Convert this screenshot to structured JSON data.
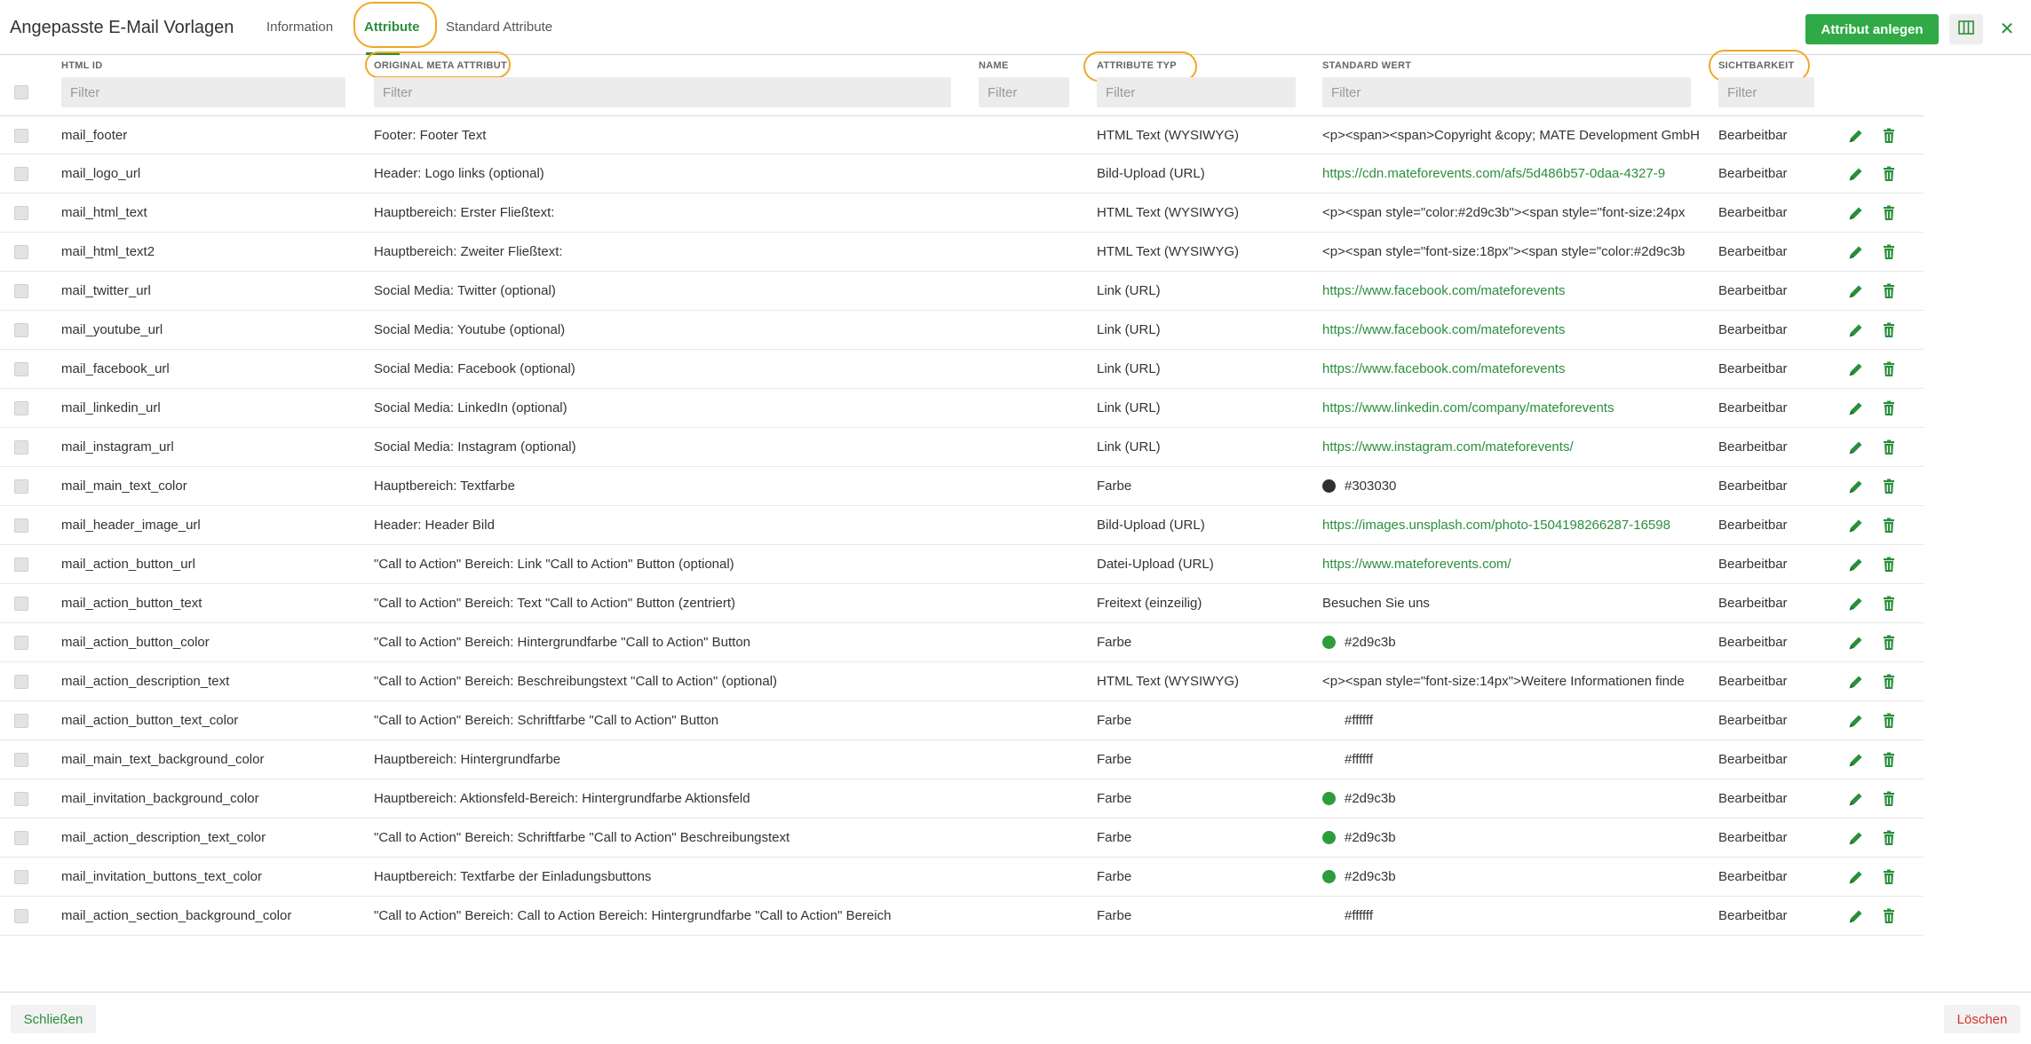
{
  "header": {
    "title": "Angepasste E-Mail Vorlagen",
    "tabs": [
      {
        "label": "Information",
        "active": false
      },
      {
        "label": "Attribute",
        "active": true
      },
      {
        "label": "Standard Attribute",
        "active": false
      }
    ],
    "add_button": "Attribut anlegen",
    "columns_icon": "columns-icon",
    "close_icon": "close-icon",
    "close_glyph": "✕"
  },
  "columns": {
    "html_id": "HTML ID",
    "meta": "ORIGINAL META ATTRIBUT",
    "name": "NAME",
    "type": "ATTRIBUTE TYP",
    "value": "STANDARD WERT",
    "visibility": "SICHTBARKEIT"
  },
  "filter_placeholder": "Filter",
  "colors": {
    "accent": "#2faa47",
    "link": "#2a8f3c",
    "danger": "#d9302a",
    "highlight": "#f0a825"
  },
  "rows": [
    {
      "html_id": "mail_footer",
      "meta": "Footer: Footer Text",
      "name": "",
      "type": "HTML Text (WYSIWYG)",
      "value": "<p><span><span>Copyright &copy; MATE Development GmbH",
      "kind": "text",
      "visibility": "Bearbeitbar"
    },
    {
      "html_id": "mail_logo_url",
      "meta": "Header: Logo links (optional)",
      "name": "",
      "type": "Bild-Upload (URL)",
      "value": "https://cdn.mateforevents.com/afs/5d486b57-0daa-4327-9",
      "kind": "link",
      "visibility": "Bearbeitbar"
    },
    {
      "html_id": "mail_html_text",
      "meta": "Hauptbereich: Erster Fließtext:",
      "name": "",
      "type": "HTML Text (WYSIWYG)",
      "value": "<p><span style=\"color:#2d9c3b\"><span style=\"font-size:24px",
      "kind": "text",
      "visibility": "Bearbeitbar"
    },
    {
      "html_id": "mail_html_text2",
      "meta": "Hauptbereich: Zweiter Fließtext:",
      "name": "",
      "type": "HTML Text (WYSIWYG)",
      "value": "<p><span style=\"font-size:18px\"><span style=\"color:#2d9c3b",
      "kind": "text",
      "visibility": "Bearbeitbar"
    },
    {
      "html_id": "mail_twitter_url",
      "meta": "Social Media: Twitter (optional)",
      "name": "",
      "type": "Link (URL)",
      "value": "https://www.facebook.com/mateforevents",
      "kind": "link",
      "visibility": "Bearbeitbar"
    },
    {
      "html_id": "mail_youtube_url",
      "meta": "Social Media: Youtube (optional)",
      "name": "",
      "type": "Link (URL)",
      "value": "https://www.facebook.com/mateforevents",
      "kind": "link",
      "visibility": "Bearbeitbar"
    },
    {
      "html_id": "mail_facebook_url",
      "meta": "Social Media: Facebook (optional)",
      "name": "",
      "type": "Link (URL)",
      "value": "https://www.facebook.com/mateforevents",
      "kind": "link",
      "visibility": "Bearbeitbar"
    },
    {
      "html_id": "mail_linkedin_url",
      "meta": "Social Media: LinkedIn (optional)",
      "name": "",
      "type": "Link (URL)",
      "value": "https://www.linkedin.com/company/mateforevents",
      "kind": "link",
      "visibility": "Bearbeitbar"
    },
    {
      "html_id": "mail_instagram_url",
      "meta": "Social Media: Instagram (optional)",
      "name": "",
      "type": "Link (URL)",
      "value": "https://www.instagram.com/mateforevents/",
      "kind": "link",
      "visibility": "Bearbeitbar"
    },
    {
      "html_id": "mail_main_text_color",
      "meta": "Hauptbereich: Textfarbe",
      "name": "",
      "type": "Farbe",
      "value": "#303030",
      "kind": "color",
      "swatch": "#303030",
      "visibility": "Bearbeitbar"
    },
    {
      "html_id": "mail_header_image_url",
      "meta": "Header: Header Bild",
      "name": "",
      "type": "Bild-Upload (URL)",
      "value": "https://images.unsplash.com/photo-1504198266287-16598",
      "kind": "link",
      "visibility": "Bearbeitbar"
    },
    {
      "html_id": "mail_action_button_url",
      "meta": "\"Call to Action\" Bereich: Link \"Call to Action\" Button (optional)",
      "name": "",
      "type": "Datei-Upload (URL)",
      "value": "https://www.mateforevents.com/",
      "kind": "link",
      "visibility": "Bearbeitbar"
    },
    {
      "html_id": "mail_action_button_text",
      "meta": "\"Call to Action\" Bereich: Text \"Call to Action\" Button (zentriert)",
      "name": "",
      "type": "Freitext (einzeilig)",
      "value": "Besuchen Sie uns",
      "kind": "text",
      "visibility": "Bearbeitbar"
    },
    {
      "html_id": "mail_action_button_color",
      "meta": "\"Call to Action\" Bereich: Hintergrundfarbe \"Call to Action\" Button",
      "name": "",
      "type": "Farbe",
      "value": "#2d9c3b",
      "kind": "color",
      "swatch": "#2d9c3b",
      "visibility": "Bearbeitbar"
    },
    {
      "html_id": "mail_action_description_text",
      "meta": "\"Call to Action\" Bereich: Beschreibungstext \"Call to Action\" (optional)",
      "name": "",
      "type": "HTML Text (WYSIWYG)",
      "value": "<p><span style=\"font-size:14px\">Weitere Informationen finde",
      "kind": "text",
      "visibility": "Bearbeitbar"
    },
    {
      "html_id": "mail_action_button_text_color",
      "meta": "\"Call to Action\" Bereich: Schriftfarbe \"Call to Action\" Button",
      "name": "",
      "type": "Farbe",
      "value": "#ffffff",
      "kind": "color",
      "swatch": "#ffffff",
      "visibility": "Bearbeitbar"
    },
    {
      "html_id": "mail_main_text_background_color",
      "meta": "Hauptbereich: Hintergrundfarbe",
      "name": "",
      "type": "Farbe",
      "value": "#ffffff",
      "kind": "color",
      "swatch": "#ffffff",
      "visibility": "Bearbeitbar"
    },
    {
      "html_id": "mail_invitation_background_color",
      "meta": "Hauptbereich: Aktionsfeld-Bereich: Hintergrundfarbe Aktionsfeld",
      "name": "",
      "type": "Farbe",
      "value": "#2d9c3b",
      "kind": "color",
      "swatch": "#2d9c3b",
      "visibility": "Bearbeitbar"
    },
    {
      "html_id": "mail_action_description_text_color",
      "meta": "\"Call to Action\" Bereich: Schriftfarbe \"Call to Action\" Beschreibungstext",
      "name": "",
      "type": "Farbe",
      "value": "#2d9c3b",
      "kind": "color",
      "swatch": "#2d9c3b",
      "visibility": "Bearbeitbar"
    },
    {
      "html_id": "mail_invitation_buttons_text_color",
      "meta": "Hauptbereich: Textfarbe der Einladungsbuttons",
      "name": "",
      "type": "Farbe",
      "value": "#2d9c3b",
      "kind": "color",
      "swatch": "#2d9c3b",
      "visibility": "Bearbeitbar"
    },
    {
      "html_id": "mail_action_section_background_color",
      "meta": "\"Call to Action\" Bereich: Call to Action Bereich: Hintergrundfarbe \"Call to Action\" Bereich",
      "name": "",
      "type": "Farbe",
      "value": "#ffffff",
      "kind": "color",
      "swatch": "#ffffff",
      "visibility": "Bearbeitbar"
    }
  ],
  "row_actions": {
    "edit_icon": "pencil-icon",
    "delete_icon": "trash-icon"
  },
  "footer": {
    "close_label": "Schließen",
    "delete_label": "Löschen"
  }
}
